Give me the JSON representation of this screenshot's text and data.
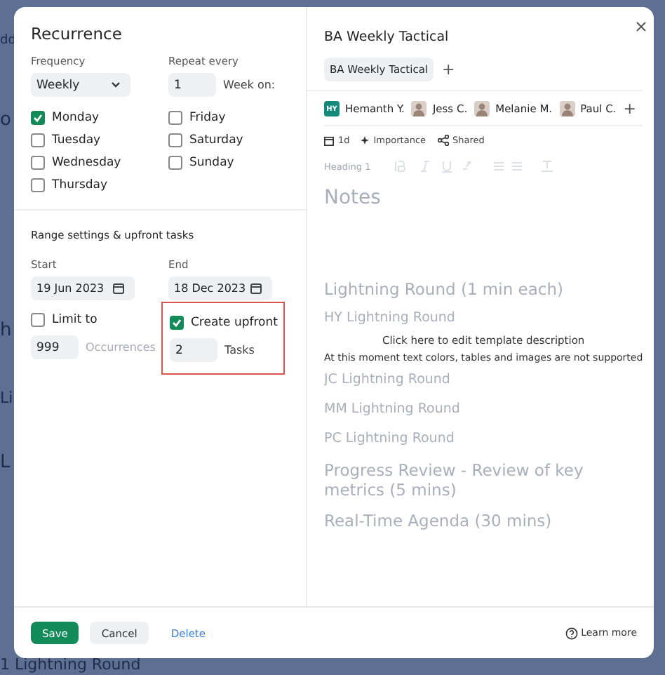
{
  "backdrop": {
    "fragments": [
      "dd",
      "o",
      "h",
      "Li",
      "L"
    ],
    "footer_text": "1 Lightning Round"
  },
  "recurrence": {
    "title": "Recurrence",
    "frequency": {
      "label": "Frequency",
      "value": "Weekly"
    },
    "repeat_every": {
      "label": "Repeat every",
      "value": "1",
      "unit": "Week on:"
    },
    "days": [
      {
        "label": "Monday",
        "checked": true
      },
      {
        "label": "Tuesday",
        "checked": false
      },
      {
        "label": "Wednesday",
        "checked": false
      },
      {
        "label": "Thursday",
        "checked": false
      },
      {
        "label": "Friday",
        "checked": false
      },
      {
        "label": "Saturday",
        "checked": false
      },
      {
        "label": "Sunday",
        "checked": false
      }
    ],
    "range_title": "Range settings & upfront tasks",
    "start": {
      "label": "Start",
      "value": "19 Jun 2023"
    },
    "end": {
      "label": "End",
      "value": "18 Dec 2023"
    },
    "limit": {
      "label": "Limit to",
      "checked": false,
      "value": "999",
      "unit": "Occurrences"
    },
    "upfront": {
      "label": "Create upfront",
      "checked": true,
      "value": "2",
      "unit": "Tasks",
      "highlighted": true
    }
  },
  "template": {
    "title": "BA Weekly Tactical",
    "tag": "BA Weekly Tactical",
    "add_tag": "+",
    "attendees": [
      {
        "name": "Hemanth Y.",
        "initials": "HY"
      },
      {
        "name": "Jess C."
      },
      {
        "name": "Melanie M."
      },
      {
        "name": "Paul C."
      }
    ],
    "add_attendee": "+",
    "meta": [
      {
        "kind": "duration",
        "label": "1d"
      },
      {
        "kind": "importance",
        "label": "Importance"
      },
      {
        "kind": "shared",
        "label": "Shared"
      }
    ],
    "toolbar_style": "Heading 1",
    "notes": [
      {
        "kind": "h1",
        "text": "Notes"
      },
      {
        "kind": "h2",
        "text": "Lightning Round (1 min each)"
      },
      {
        "kind": "h3",
        "text": "HY Lightning Round"
      },
      {
        "kind": "h3",
        "text": "JC Lightning Round"
      },
      {
        "kind": "h3",
        "text": "MM Lightning Round"
      },
      {
        "kind": "h3",
        "text": "PC Lightning Round"
      },
      {
        "kind": "h2",
        "text": "Progress Review - Review of key metrics (5 mins)"
      },
      {
        "kind": "h2",
        "text": "Real-Time Agenda (30 mins)"
      }
    ],
    "overlay_title": "Click here to edit template description",
    "overlay_note": "At this moment text colors, tables and images are not supported"
  },
  "footer": {
    "buttons": [
      {
        "kind": "primary",
        "label": "Save"
      },
      {
        "kind": "secondary",
        "label": "Cancel"
      },
      {
        "kind": "link",
        "label": "Delete"
      }
    ],
    "help": "Learn more"
  }
}
